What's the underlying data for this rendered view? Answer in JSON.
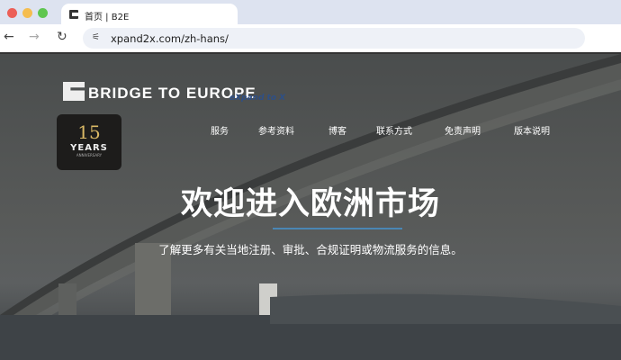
{
  "browser": {
    "tab_title": "首页 | B2E",
    "url": "xpand2x.com/zh-hans/"
  },
  "site": {
    "logo_text": "BRIDGE TO EUROPE",
    "tagline": "eXpand to X",
    "badge": {
      "number": "15",
      "years": "YEARS",
      "anniversary": "ANNIVERSARY"
    },
    "menu": [
      "服务",
      "参考资料",
      "博客",
      "联系方式",
      "免责声明",
      "版本说明"
    ],
    "hero_title": "欢迎进入欧洲市场",
    "hero_subtitle": "了解更多有关当地注册、审批、合规证明或物流服务的信息。"
  },
  "colors": {
    "accent_line": "#4a86b4",
    "tagline": "#2e4f86"
  }
}
